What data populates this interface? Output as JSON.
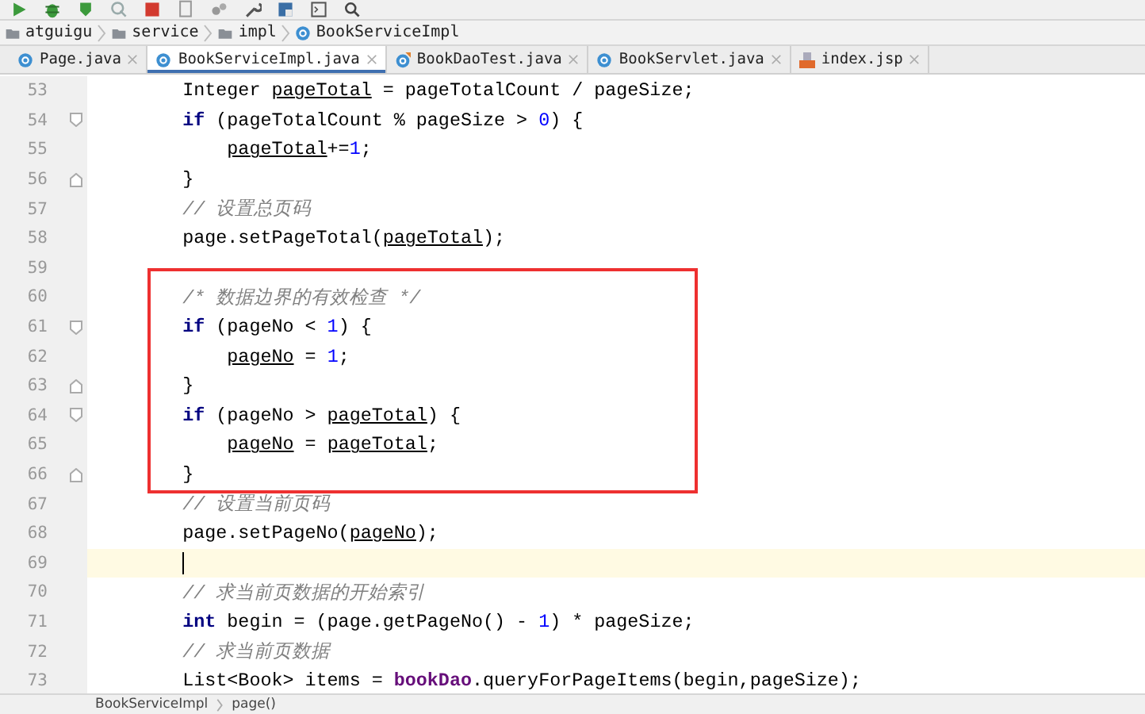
{
  "toolbar": {
    "buttons": [
      {
        "kind": "run"
      },
      {
        "kind": "debug"
      },
      {
        "kind": "coverage"
      },
      {
        "kind": "profile"
      },
      {
        "kind": "stop"
      },
      {
        "kind": "build"
      },
      {
        "kind": "deploy"
      },
      {
        "kind": "settings"
      },
      {
        "kind": "structure"
      },
      {
        "kind": "terminal"
      },
      {
        "kind": "search"
      }
    ]
  },
  "breadcrumb": [
    {
      "label": "atguigu",
      "kind": "folder"
    },
    {
      "label": "service",
      "kind": "folder"
    },
    {
      "label": "impl",
      "kind": "folder"
    },
    {
      "label": "BookServiceImpl",
      "kind": "class"
    }
  ],
  "tabs": [
    {
      "label": "Page.java",
      "kind": "class",
      "selected": false
    },
    {
      "label": "BookServiceImpl.java",
      "kind": "class",
      "selected": true
    },
    {
      "label": "BookDaoTest.java",
      "kind": "test",
      "selected": false
    },
    {
      "label": "BookServlet.java",
      "kind": "class",
      "selected": false
    },
    {
      "label": "index.jsp",
      "kind": "jsp",
      "selected": false
    }
  ],
  "editor": {
    "blocks": [
      {
        "lines": [
          {
            "number": "53",
            "tokens": [
              {
                "kind": "plain",
                "text": "        Integer "
              },
              {
                "kind": "var",
                "text": "pageTotal"
              },
              {
                "kind": "plain",
                "text": " = pageTotalCount / pageSize;"
              }
            ]
          },
          {
            "number": "54",
            "fold_start": true,
            "tokens": [
              {
                "kind": "keyword",
                "text": "        if"
              },
              {
                "kind": "plain",
                "text": " (pageTotalCount % pageSize > "
              },
              {
                "kind": "number",
                "text": "0"
              },
              {
                "kind": "plain",
                "text": ") {"
              }
            ]
          },
          {
            "number": "55",
            "tokens": [
              {
                "kind": "var",
                "text": "            pageTotal"
              },
              {
                "kind": "plain",
                "text": "+="
              },
              {
                "kind": "number",
                "text": "1"
              },
              {
                "kind": "plain",
                "text": ";"
              }
            ]
          },
          {
            "number": "56",
            "fold_end": true,
            "tokens": [
              {
                "kind": "plain",
                "text": "        }"
              }
            ]
          },
          {
            "number": "57",
            "tokens": [
              {
                "kind": "comment",
                "text": "        // 设置总页码"
              }
            ]
          },
          {
            "number": "58",
            "tokens": [
              {
                "kind": "plain",
                "text": "        page.setPageTotal("
              },
              {
                "kind": "var",
                "text": "pageTotal"
              },
              {
                "kind": "plain",
                "text": ");"
              }
            ]
          },
          {
            "number": "59"
          }
        ]
      },
      {
        "boxed": true,
        "lines": [
          {
            "number": "60",
            "tokens": [
              {
                "kind": "comment",
                "text": "        /* 数据边界的有效检查 */"
              }
            ]
          },
          {
            "number": "61",
            "fold_start": true,
            "tokens": [
              {
                "kind": "keyword",
                "text": "        if"
              },
              {
                "kind": "plain",
                "text": " (pageNo < "
              },
              {
                "kind": "number",
                "text": "1"
              },
              {
                "kind": "plain",
                "text": ") {"
              }
            ]
          },
          {
            "number": "62",
            "tokens": [
              {
                "kind": "var",
                "text": "            pageNo"
              },
              {
                "kind": "plain",
                "text": " = "
              },
              {
                "kind": "number",
                "text": "1"
              },
              {
                "kind": "plain",
                "text": ";"
              }
            ]
          },
          {
            "number": "63",
            "fold_end": true,
            "tokens": [
              {
                "kind": "plain",
                "text": "        }"
              }
            ]
          },
          {
            "number": "64",
            "fold_start": true,
            "tokens": [
              {
                "kind": "keyword",
                "text": "        if"
              },
              {
                "kind": "plain",
                "text": " (pageNo > "
              },
              {
                "kind": "var",
                "text": "pageTotal"
              },
              {
                "kind": "plain",
                "text": ") {"
              }
            ]
          },
          {
            "number": "65",
            "tokens": [
              {
                "kind": "var",
                "text": "            pageNo"
              },
              {
                "kind": "plain",
                "text": " = "
              },
              {
                "kind": "var",
                "text": "pageTotal"
              },
              {
                "kind": "plain",
                "text": ";"
              }
            ]
          },
          {
            "number": "66",
            "fold_end": true,
            "tokens": [
              {
                "kind": "plain",
                "text": "        }"
              }
            ]
          }
        ]
      },
      {
        "lines": [
          {
            "number": "67",
            "tokens": [
              {
                "kind": "comment",
                "text": "        // 设置当前页码"
              }
            ]
          },
          {
            "number": "68",
            "tokens": [
              {
                "kind": "plain",
                "text": "        page.setPageNo("
              },
              {
                "kind": "var",
                "text": "pageNo"
              },
              {
                "kind": "plain",
                "text": ");"
              }
            ]
          },
          {
            "number": "69",
            "current": true
          },
          {
            "number": "70",
            "tokens": [
              {
                "kind": "comment",
                "text": "        // 求当前页数据的开始索引"
              }
            ]
          },
          {
            "number": "71",
            "tokens": [
              {
                "kind": "keyword",
                "text": "        int"
              },
              {
                "kind": "plain",
                "text": " begin = (page.getPageNo() - "
              },
              {
                "kind": "number",
                "text": "1"
              },
              {
                "kind": "plain",
                "text": ") * pageSize;"
              }
            ]
          },
          {
            "number": "72",
            "tokens": [
              {
                "kind": "comment",
                "text": "        // 求当前页数据"
              }
            ]
          },
          {
            "number": "73",
            "tokens": [
              {
                "kind": "plain",
                "text": "        List<Book> items = "
              },
              {
                "kind": "field",
                "text": "bookDao"
              },
              {
                "kind": "plain",
                "text": ".queryForPageItems(begin,pageSize);"
              }
            ]
          }
        ]
      }
    ]
  },
  "status_breadcrumb": [
    {
      "label": "BookServiceImpl"
    },
    {
      "label": "page()"
    }
  ]
}
